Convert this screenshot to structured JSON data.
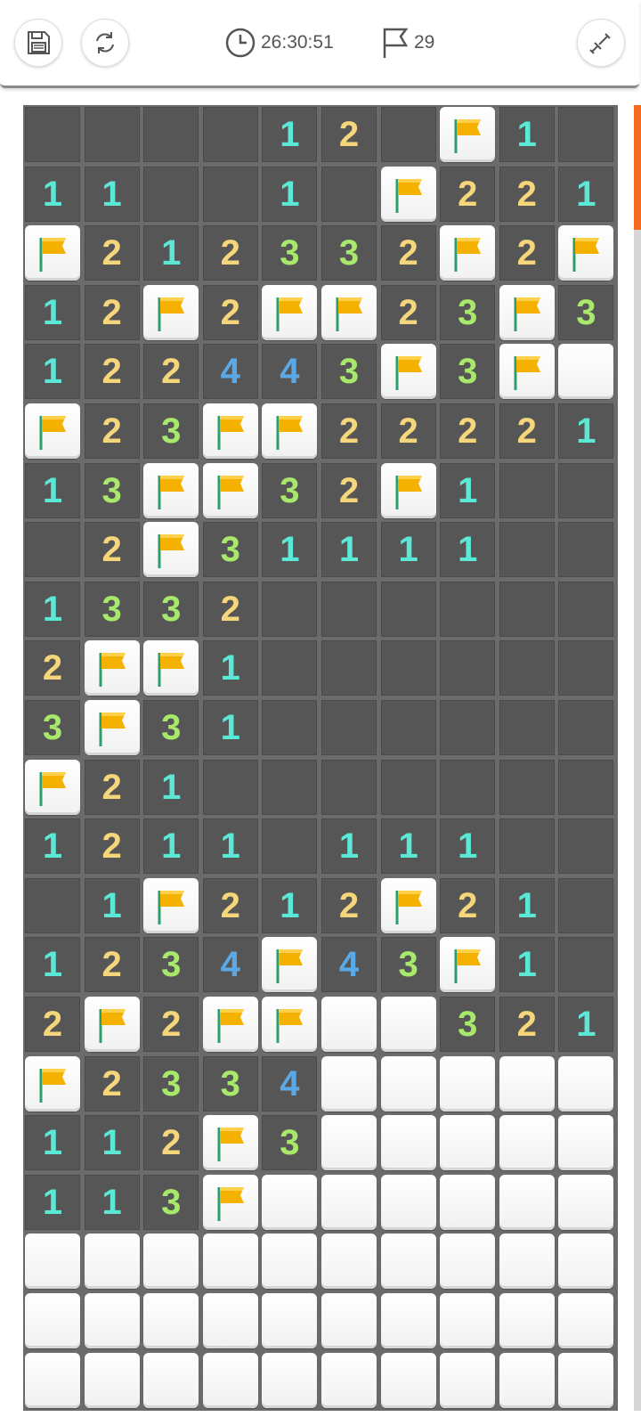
{
  "toolbar": {
    "save_icon": "floppy-disk-icon",
    "restart_icon": "refresh-icon",
    "timer_icon": "clock-icon",
    "timer": "26:30:51",
    "flag_icon": "flag-outline-icon",
    "flag_count": "29",
    "mode_icon": "shovel-icon"
  },
  "colors": {
    "open_cell": "#565656",
    "grid_line": "#6b6b6b",
    "closed_cell": "#ffffff",
    "flag": "#f5b100",
    "flag_pole": "#2e9c6c",
    "num_1": "#5ce8d6",
    "num_2": "#f6d67a",
    "num_3": "#a8e86a",
    "num_4": "#5aa9e6",
    "scroll_thumb": "#f46a1e"
  },
  "board": {
    "cols": 10,
    "rows": 22,
    "legend": "0 = revealed empty, 1-8 = revealed number, F = flagged, C = unrevealed",
    "grid": [
      "0000120F100",
      "110010F2211",
      "F212332F2F2",
      "12F2FF23F3",
      "122443F3F",
      "F23FF22221",
      "13FF32F100",
      "02F3111100",
      "1332000000",
      "2FF1000000",
      "3F31000000",
      "F210000000",
      "1211011100",
      "01F212F210",
      "1234F43F10",
      "2F2FFCC321",
      "F2334CCCCC",
      "112F3CCCCC",
      "113FCCCCCC",
      "CCCCCCCCCC",
      "CCCCCCCCCC",
      "CCCCCCCCCC"
    ]
  },
  "scrollbar": {
    "position": 0.0
  }
}
